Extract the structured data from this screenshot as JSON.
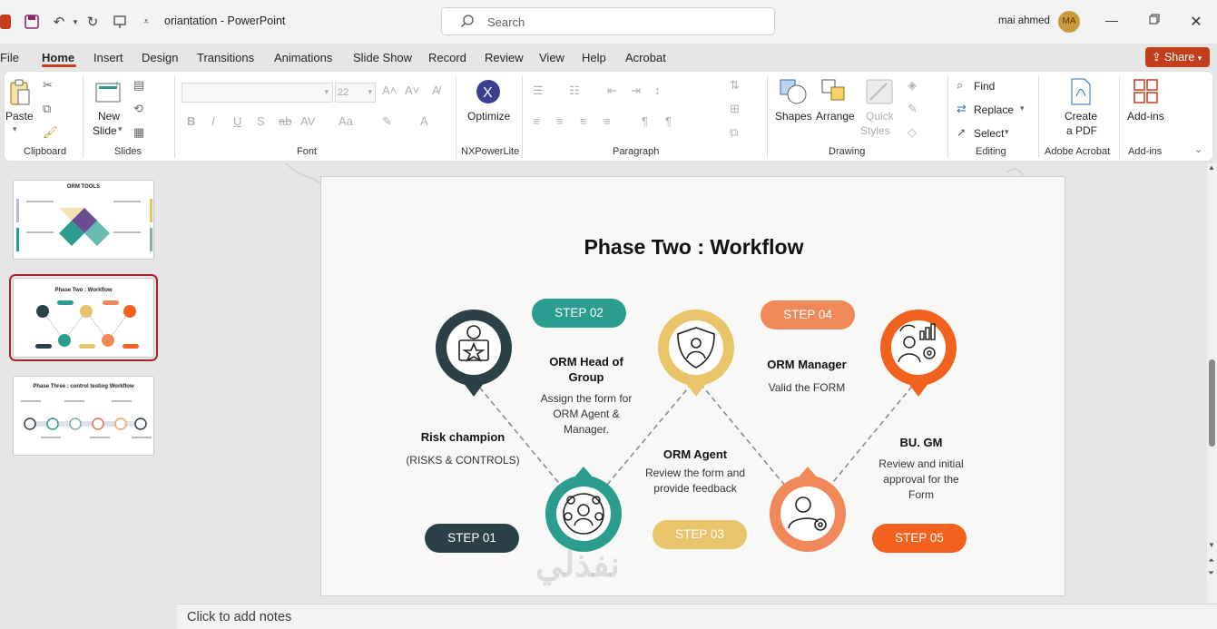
{
  "app": {
    "doc_title": "oriantation",
    "app_name": "PowerPoint",
    "title_sep": " - ",
    "search_placeholder": "Search",
    "user_name": "mai ahmed",
    "user_initials": "MA",
    "share_label": "Share"
  },
  "tabs": [
    "File",
    "Home",
    "Insert",
    "Design",
    "Transitions",
    "Animations",
    "Slide Show",
    "Record",
    "Review",
    "View",
    "Help",
    "Acrobat"
  ],
  "ribbon": {
    "paste": "Paste",
    "new_slide_1": "New",
    "new_slide_2": "Slide",
    "font_size": "22",
    "optimize": "Optimize",
    "shapes": "Shapes",
    "arrange": "Arrange",
    "quick_styles_1": "Quick",
    "quick_styles_2": "Styles",
    "find": "Find",
    "replace": "Replace",
    "select": "Select",
    "create_pdf_1": "Create",
    "create_pdf_2": "a PDF",
    "add_ins": "Add-ins",
    "groups": [
      "Clipboard",
      "Slides",
      "Font",
      "NXPowerLite",
      "Paragraph",
      "Drawing",
      "Editing",
      "Adobe Acrobat",
      "Add-ins"
    ]
  },
  "thumbnails": {
    "t1_title": "ORM TOOLS",
    "t2_title": "Phase Two : Workflow",
    "t3_title": "Phase Three : control testing Workflow"
  },
  "slide": {
    "title": "Phase Two : Workflow",
    "steps": [
      {
        "label": "STEP 01",
        "title": "Risk champion",
        "desc": "(RISKS & CONTROLS)",
        "color": "#2b4047"
      },
      {
        "label": "STEP 02",
        "title": "ORM Head of Group",
        "desc": "Assign the form for ORM Agent & Manager.",
        "color": "#2a9d8f"
      },
      {
        "label": "STEP 03",
        "title": "ORM Agent",
        "desc": "Review the form and provide feedback",
        "color": "#e9c46a"
      },
      {
        "label": "STEP 04",
        "title": "ORM Manager",
        "desc": "Valid the FORM",
        "color": "#f0885a"
      },
      {
        "label": "STEP 05",
        "title": "BU. GM",
        "desc": "Review and initial approval for the Form",
        "color": "#f2621e"
      }
    ]
  },
  "notes_placeholder": "Click to add notes"
}
